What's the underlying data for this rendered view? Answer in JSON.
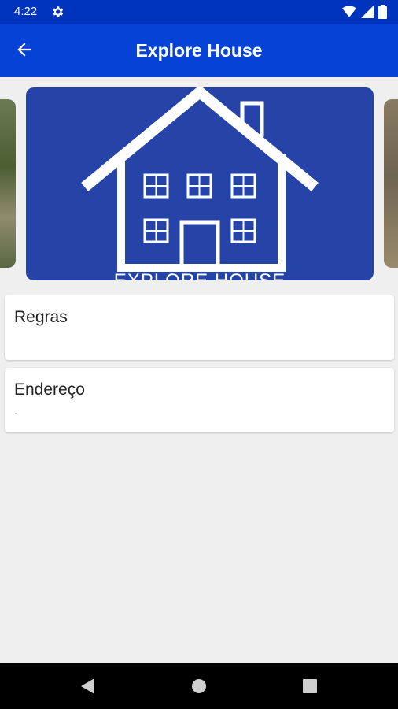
{
  "status_bar": {
    "time": "4:22"
  },
  "app_bar": {
    "title": "Explore House"
  },
  "carousel": {
    "watermark_text": "EXPLORE HOUSE"
  },
  "cards": [
    {
      "title": "Regras",
      "value": ""
    },
    {
      "title": "Endereço",
      "value": "."
    }
  ],
  "colors": {
    "status_bar": "#0033bb",
    "app_bar": "#0542d6",
    "logo_background": "#2644a8",
    "page_background": "#efefef"
  },
  "icons": [
    "settings-gear-icon",
    "wifi-icon",
    "signal-icon",
    "battery-icon",
    "back-arrow-icon",
    "nav-back-icon",
    "nav-home-icon",
    "nav-recents-icon"
  ]
}
